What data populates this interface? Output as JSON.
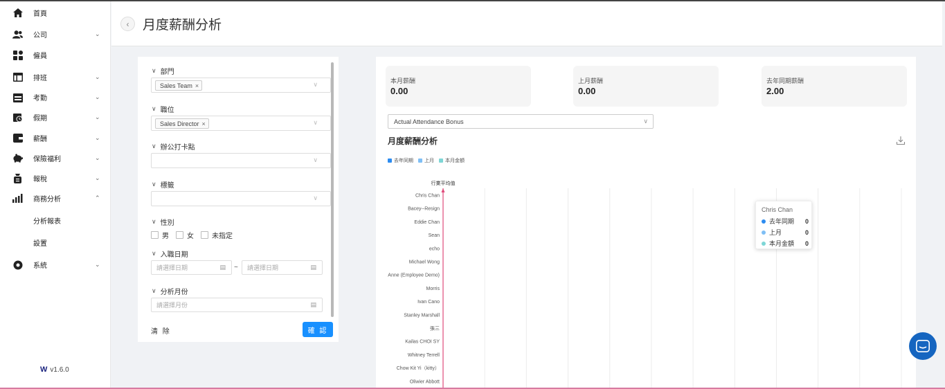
{
  "sidebar": {
    "items": [
      {
        "label": "首頁",
        "icon": "home-icon",
        "chevron": ""
      },
      {
        "label": "公司",
        "icon": "users-icon",
        "chevron": "⌄"
      },
      {
        "label": "僱員",
        "icon": "grid-icon",
        "chevron": ""
      },
      {
        "label": "排班",
        "icon": "table-icon",
        "chevron": "⌄"
      },
      {
        "label": "考勤",
        "icon": "calendar-icon",
        "chevron": "⌄"
      },
      {
        "label": "假期",
        "icon": "calendar-clock-icon",
        "chevron": "⌄"
      },
      {
        "label": "薪酬",
        "icon": "wallet-icon",
        "chevron": "⌄"
      },
      {
        "label": "保險福利",
        "icon": "piggy-bank-icon",
        "chevron": "⌄"
      },
      {
        "label": "報稅",
        "icon": "tax-icon",
        "chevron": "⌄"
      },
      {
        "label": "商務分析",
        "icon": "bar-chart-icon",
        "chevron": "⌃"
      }
    ],
    "subitems": [
      {
        "label": "分析報表"
      },
      {
        "label": "設置"
      }
    ],
    "system": {
      "label": "系統",
      "icon": "gear-icon",
      "chevron": "⌄"
    },
    "version": "v1.6.0"
  },
  "header": {
    "title": "月度薪酬分析"
  },
  "filters": {
    "department": {
      "label": "部門",
      "tag": "Sales Team"
    },
    "position": {
      "label": "職位",
      "tag": "Sales Director"
    },
    "office": {
      "label": "辦公打卡點"
    },
    "tags": {
      "label": "標籤"
    },
    "gender": {
      "label": "性別",
      "options": [
        "男",
        "女",
        "未指定"
      ]
    },
    "join_date": {
      "label": "入職日期",
      "start_placeholder": "請選擇日期",
      "end_placeholder": "請選擇日期",
      "separator": "~"
    },
    "month": {
      "label": "分析月份",
      "placeholder": "請選擇月份"
    },
    "clear_label": "清 除",
    "confirm_label": "確 認"
  },
  "stats": [
    {
      "label": "本月薪酬",
      "value": "0.00"
    },
    {
      "label": "上月薪酬",
      "value": "0.00"
    },
    {
      "label": "去年同期薪酬",
      "value": "2.00"
    }
  ],
  "dropdown": {
    "value": "Actual Attendance Bonus"
  },
  "chart_data": {
    "type": "bar",
    "orientation": "horizontal",
    "title": "月度薪酬分析",
    "reference_line_label": "行業平均值",
    "categories": [
      "Chris Chan",
      "Bacey--Resign",
      "Eddie Chan",
      "Sean",
      "echo",
      "Michael Wong",
      "Anne (Employee Demo)",
      "Morris",
      "Ivan Cano",
      "Stanley Marshall",
      "張三",
      "Kailas CHOI SY",
      "Whitney Terrell",
      "Chow Kit Yi（kitty）",
      "Oliwier Abbott"
    ],
    "series": [
      {
        "name": "去年同期",
        "color": "#2d8cf0",
        "values": [
          0,
          0,
          0,
          0,
          0,
          0,
          0,
          0,
          0,
          0,
          0,
          0,
          0,
          0,
          0
        ]
      },
      {
        "name": "上月",
        "color": "#7fbff5",
        "values": [
          0,
          0,
          0,
          0,
          0,
          0,
          0,
          0,
          0,
          0,
          0,
          0,
          0,
          0,
          0
        ]
      },
      {
        "name": "本月金額",
        "color": "#7ed6d6",
        "values": [
          0,
          0,
          0,
          0,
          0,
          0,
          0,
          0,
          0,
          0,
          0,
          0,
          0,
          0,
          0
        ]
      }
    ],
    "grid": true,
    "legend_position": "top-left"
  },
  "tooltip": {
    "title": "Chris Chan",
    "rows": [
      {
        "name": "去年同期",
        "value": "0",
        "color": "#2d8cf0"
      },
      {
        "name": "上月",
        "value": "0",
        "color": "#7fbff5"
      },
      {
        "name": "本月金額",
        "value": "0",
        "color": "#7ed6d6"
      }
    ]
  }
}
